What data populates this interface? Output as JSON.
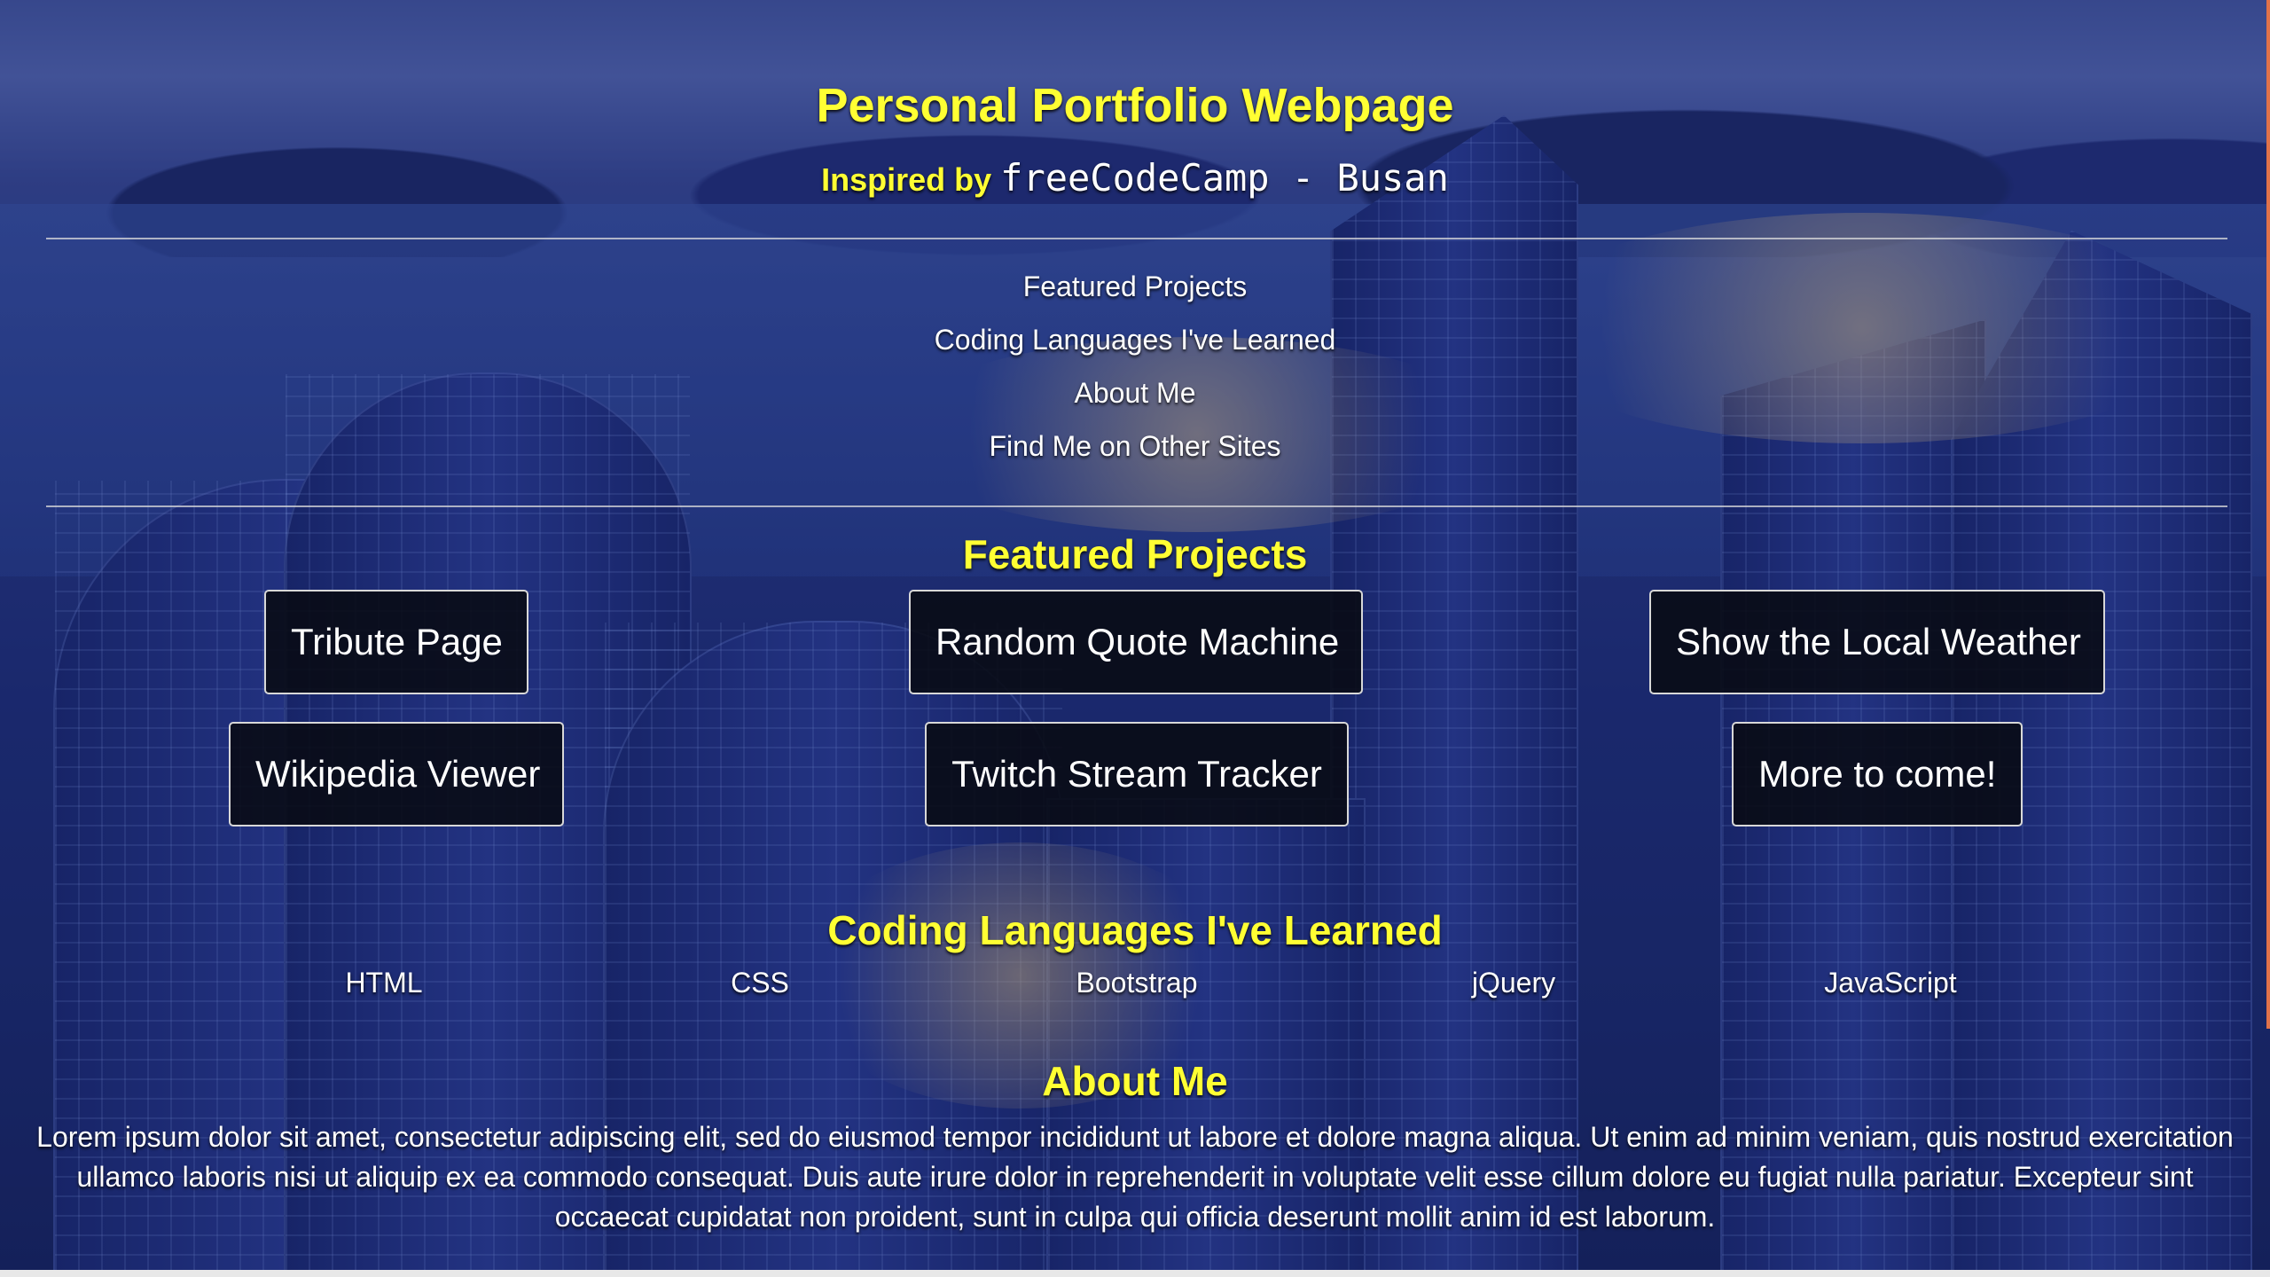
{
  "header": {
    "title": "Personal Portfolio Webpage",
    "subtitle_prefix": "Inspired by",
    "subtitle_code": "freeCodeCamp - Busan"
  },
  "nav": {
    "items": [
      {
        "label": "Featured Projects"
      },
      {
        "label": "Coding Languages I've Learned"
      },
      {
        "label": "About Me"
      },
      {
        "label": "Find Me on Other Sites"
      }
    ]
  },
  "projects": {
    "heading": "Featured Projects",
    "items": [
      {
        "label": "Tribute Page"
      },
      {
        "label": "Random Quote Machine"
      },
      {
        "label": "Show the Local Weather"
      },
      {
        "label": "Wikipedia Viewer"
      },
      {
        "label": "Twitch Stream Tracker"
      },
      {
        "label": "More to come!"
      }
    ]
  },
  "languages": {
    "heading": "Coding Languages I've Learned",
    "items": [
      "HTML",
      "CSS",
      "Bootstrap",
      "jQuery",
      "JavaScript"
    ]
  },
  "about": {
    "heading": "About Me",
    "text": "Lorem ipsum dolor sit amet, consectetur adipiscing elit, sed do eiusmod tempor incididunt ut labore et dolore magna aliqua. Ut enim ad minim veniam, quis nostrud exercitation ullamco laboris nisi ut aliquip ex ea commodo consequat. Duis aute irure dolor in reprehenderit in voluptate velit esse cillum dolore eu fugiat nulla pariatur. Excepteur sint occaecat cupidatat non proident, sunt in culpa qui officia deserunt mollit anim id est laborum."
  },
  "colors": {
    "heading": "#ffff33",
    "text": "#ffffff",
    "button_bg": "#080a12"
  }
}
